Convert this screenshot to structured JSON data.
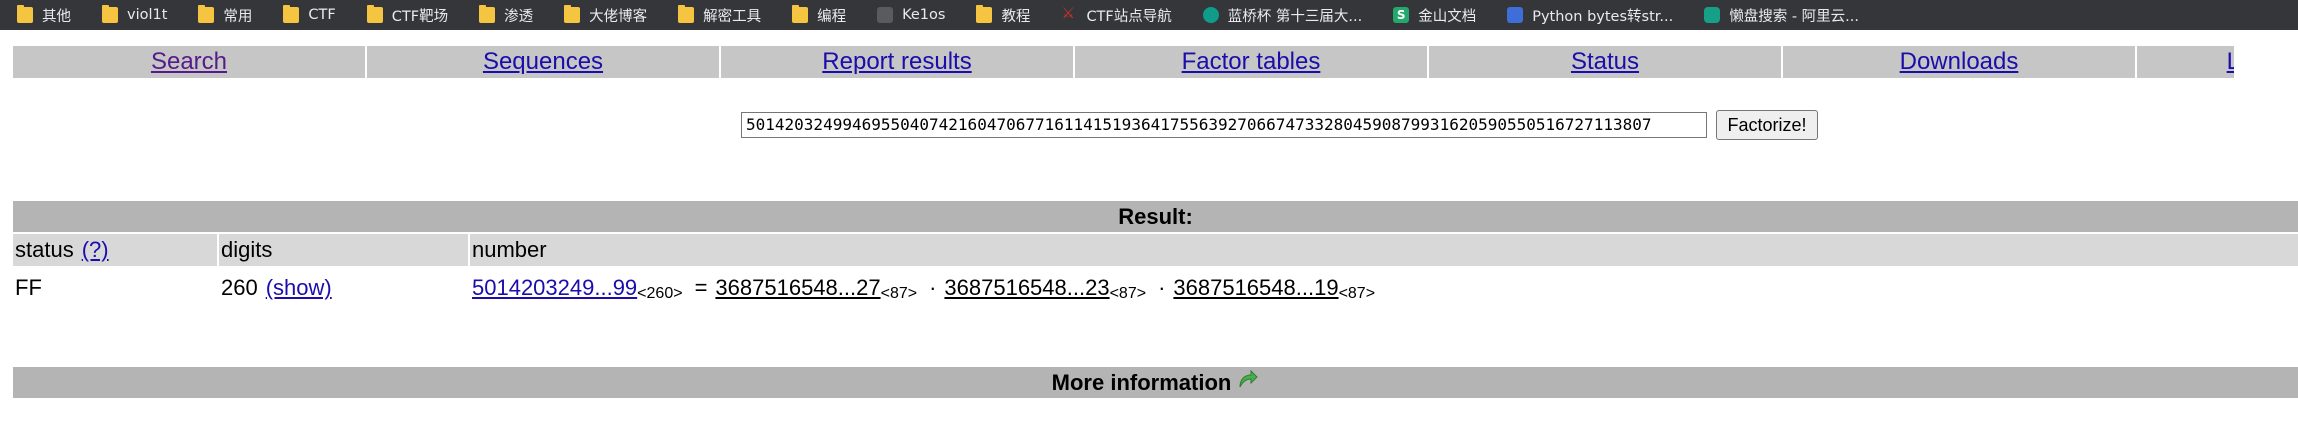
{
  "bookmarks": [
    {
      "label": "其他",
      "icon": "folder-icon"
    },
    {
      "label": "viol1t",
      "icon": "folder-icon"
    },
    {
      "label": "常用",
      "icon": "folder-icon"
    },
    {
      "label": "CTF",
      "icon": "folder-icon"
    },
    {
      "label": "CTF靶场",
      "icon": "folder-icon"
    },
    {
      "label": "渗透",
      "icon": "folder-icon"
    },
    {
      "label": "大佬博客",
      "icon": "folder-icon"
    },
    {
      "label": "解密工具",
      "icon": "folder-icon"
    },
    {
      "label": "编程",
      "icon": "folder-icon"
    },
    {
      "label": "Ke1os",
      "icon": "app-icon"
    },
    {
      "label": "教程",
      "icon": "folder-icon"
    },
    {
      "label": "CTF站点导航",
      "icon": "ctf-icon"
    },
    {
      "label": "蓝桥杯 第十三届大...",
      "icon": "lanqiao-icon"
    },
    {
      "label": "金山文档",
      "icon": "wps-icon"
    },
    {
      "label": "Python bytes转str...",
      "icon": "python-icon"
    },
    {
      "label": "懒盘搜索 - 阿里云...",
      "icon": "lanpan-icon"
    }
  ],
  "nav": {
    "items": [
      "Search",
      "Sequences",
      "Report results",
      "Factor tables",
      "Status",
      "Downloads",
      "L"
    ]
  },
  "search": {
    "value": "5014203249946955040742160470677161141519364175563927066747332804590879931620590550516727113807",
    "button": "Factorize!"
  },
  "result": {
    "title": "Result:",
    "headers": {
      "status": "status",
      "status_help": "(?)",
      "digits": "digits",
      "number": "number"
    },
    "row": {
      "status": "FF",
      "digits": "260",
      "show": "(show)",
      "number": "5014203249...99",
      "number_digits": "<260>",
      "equals": "=",
      "factors": [
        {
          "value": "3687516548...27",
          "digits": "<87>"
        },
        {
          "value": "3687516548...23",
          "digits": "<87>"
        },
        {
          "value": "3687516548...19",
          "digits": "<87>"
        }
      ],
      "dot": "·"
    }
  },
  "more_info": {
    "title": "More information",
    "icon": "green-arrow-icon"
  }
}
